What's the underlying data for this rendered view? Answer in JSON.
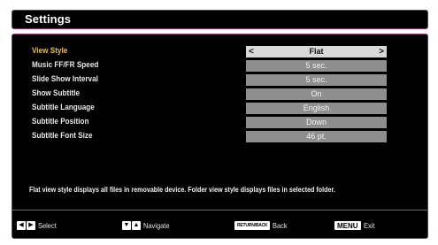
{
  "header": {
    "title": "Settings"
  },
  "settings": {
    "rows": [
      {
        "label": "View Style",
        "value": "Flat",
        "selected": true
      },
      {
        "label": "Music FF/FR Speed",
        "value": "5 sec.",
        "selected": false
      },
      {
        "label": "Slide Show Interval",
        "value": "5 sec.",
        "selected": false
      },
      {
        "label": "Show Subtitle",
        "value": "On",
        "selected": false
      },
      {
        "label": "Subtitle Language",
        "value": "English",
        "selected": false
      },
      {
        "label": "Subtitle Position",
        "value": "Down",
        "selected": false
      },
      {
        "label": "Subtitle Font Size",
        "value": "46 pt.",
        "selected": false
      }
    ],
    "arrow_left": "<",
    "arrow_right": ">"
  },
  "description": "Flat view style displays all files in removable device. Folder view style displays files in selected folder.",
  "footer": {
    "select": {
      "label": "Select",
      "key_left": "◀",
      "key_right": "▶"
    },
    "navigate": {
      "label": "Navigate",
      "key_down": "▼",
      "key_up": "▲"
    },
    "back": {
      "label": "Back",
      "key": "RETURN/BACK"
    },
    "exit": {
      "label": "Exit",
      "key": "MENU"
    }
  },
  "colors": {
    "background": "#000000",
    "border": "#8a2a86",
    "highlight_label": "#f3c418",
    "value_box": "#8e8e8e",
    "value_box_selected": "#d8d8d8"
  }
}
